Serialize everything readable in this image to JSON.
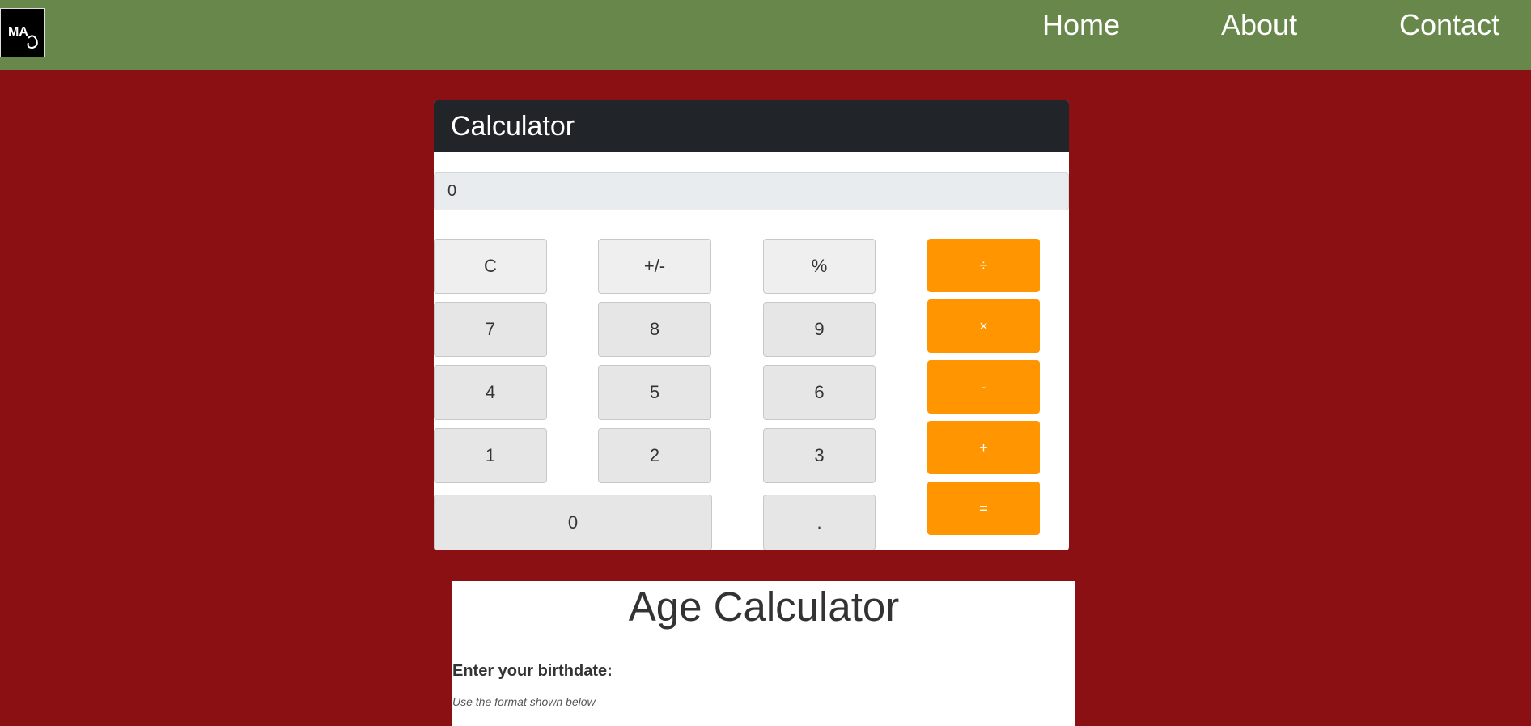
{
  "navbar": {
    "logo_text": "MA",
    "links": [
      "Home",
      "About",
      "Contact"
    ],
    "background": "#67884a"
  },
  "page": {
    "background": "#8b1013"
  },
  "calculator": {
    "title": "Calculator",
    "display_value": "0",
    "keys": {
      "clear": "C",
      "sign": "+/-",
      "percent": "%",
      "divide": "÷",
      "seven": "7",
      "eight": "8",
      "nine": "9",
      "multiply": "×",
      "four": "4",
      "five": "5",
      "six": "6",
      "minus": "-",
      "one": "1",
      "two": "2",
      "three": "3",
      "plus": "+",
      "zero": "0",
      "decimal": ".",
      "equals": "="
    },
    "operator_color": "#ff9500"
  },
  "age_calculator": {
    "title": "Age Calculator",
    "prompt": "Enter your birthdate:",
    "hint": "Use the format shown below"
  }
}
